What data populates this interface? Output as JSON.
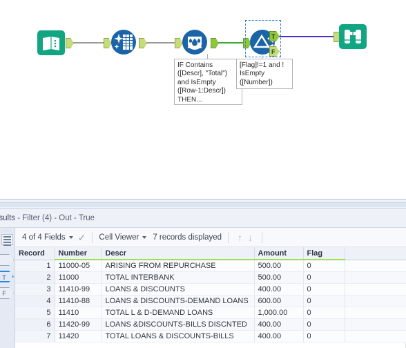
{
  "canvas": {
    "tools": [
      {
        "id": "input-data",
        "name": "input-data-tool",
        "icon": "book-icon",
        "label": "Input Data"
      },
      {
        "id": "select",
        "name": "select-tool",
        "icon": "select-icon",
        "label": "Select"
      },
      {
        "id": "formula",
        "name": "formula-tool",
        "icon": "formula-icon",
        "label": "Formula"
      },
      {
        "id": "filter",
        "name": "filter-tool",
        "icon": "filter-icon",
        "label": "Filter"
      },
      {
        "id": "browse",
        "name": "browse-tool",
        "icon": "binoculars-icon",
        "label": "Browse"
      }
    ],
    "annotations": [
      {
        "name": "formula-annotation",
        "text": "IF Contains\n([Descr], \"Total\")\nand IsEmpty\n([Row-1:Descr])\nTHEN..."
      },
      {
        "name": "filter-annotation",
        "text": "[Flag]!=1 and !\nIsEmpty\n([Number])"
      }
    ],
    "filter_anchors": {
      "true_label": "T",
      "false_label": "F"
    },
    "colors": {
      "teal": "#0e9e7e",
      "blue": "#1b6cb5",
      "wire_grey": "#9a9a9a",
      "wire_green": "#3aa836",
      "wire_blue": "#4b2fd6",
      "anchor_green": "#c6db7c",
      "selection": "#2a7fd4"
    }
  },
  "results": {
    "title_prefix": "esults",
    "title_rest": " - Filter (4) - Out - True",
    "rail": {
      "list_icon": "list-icon",
      "anchors": [
        {
          "label": "",
          "name": "rail-anchor-out",
          "selected": false
        },
        {
          "label": "T",
          "name": "rail-anchor-true",
          "selected": true
        },
        {
          "label": "F",
          "name": "rail-anchor-false",
          "selected": false
        }
      ]
    },
    "toolbar": {
      "fields_label": "4 of 4 Fields",
      "check_icon": "checkmark-icon",
      "viewer_label": "Cell Viewer",
      "records_label": "7 records displayed",
      "up_arrow": "↑",
      "down_arrow": "↓"
    },
    "grid": {
      "columns": [
        "Record",
        "Number",
        "Descr",
        "Amount",
        "Flag"
      ],
      "rows": [
        [
          "1",
          "11000-05",
          "ARISING FROM REPURCHASE",
          "500.00",
          "0"
        ],
        [
          "2",
          "11000",
          "TOTAL INTERBANK",
          "500.00",
          "0"
        ],
        [
          "3",
          "11410-99",
          "LOANS & DISCOUNTS",
          "400.00",
          "0"
        ],
        [
          "4",
          "11410-88",
          "LOANS & DISCOUNTS-DEMAND LOANS",
          "600.00",
          "0"
        ],
        [
          "5",
          "11410",
          "TOTAL L & D-DEMAND LOANS",
          "1,000.00",
          "0"
        ],
        [
          "6",
          "11420-99",
          "LOANS &DISCOUNTS-BILLS DISCNTED",
          "400.00",
          "0"
        ],
        [
          "7",
          "11420",
          "TOTAL LOANS & DISCOUNTS-BILLS",
          "400.00",
          "0"
        ]
      ]
    }
  }
}
